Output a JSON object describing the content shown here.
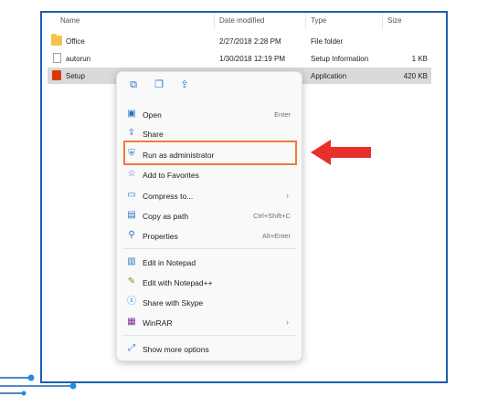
{
  "explorer": {
    "columns": {
      "name": "Name",
      "date": "Date modified",
      "type": "Type",
      "size": "Size"
    },
    "rows": [
      {
        "name": "Office",
        "date": "2/27/2018 2:28 PM",
        "type": "File folder",
        "size": "",
        "icon": "folder-icon"
      },
      {
        "name": "autorun",
        "date": "1/30/2018 12:19 PM",
        "type": "Setup Information",
        "size": "1 KB",
        "icon": "document-icon"
      },
      {
        "name": "Setup",
        "date": "",
        "type": "Application",
        "size": "420 KB",
        "icon": "office-app-icon"
      }
    ]
  },
  "context_menu": {
    "top_icons": [
      "copy-icon",
      "paste-icon",
      "share-icon"
    ],
    "items": [
      {
        "label": "Open",
        "shortcut": "Enter",
        "icon": "open-icon"
      },
      {
        "label": "Share",
        "shortcut": "",
        "icon": "share-icon"
      },
      {
        "label": "Run as administrator",
        "shortcut": "",
        "icon": "shield-icon"
      },
      {
        "label": "Add to Favorites",
        "shortcut": "",
        "icon": "star-icon"
      },
      {
        "label": "Compress to...",
        "shortcut": "",
        "icon": "zip-icon",
        "submenu": true
      },
      {
        "label": "Copy as path",
        "shortcut": "Ctrl+Shift+C",
        "icon": "path-icon"
      },
      {
        "label": "Properties",
        "shortcut": "Alt+Enter",
        "icon": "wrench-icon"
      },
      {
        "label": "Edit in Notepad",
        "shortcut": "",
        "icon": "notepad-icon"
      },
      {
        "label": "Edit with Notepad++",
        "shortcut": "",
        "icon": "notepadpp-icon"
      },
      {
        "label": "Share with Skype",
        "shortcut": "",
        "icon": "skype-icon"
      },
      {
        "label": "WinRAR",
        "shortcut": "",
        "icon": "winrar-icon",
        "submenu": true
      },
      {
        "label": "Show more options",
        "shortcut": "",
        "icon": "more-options-icon"
      }
    ]
  },
  "colors": {
    "frame": "#1d5fb0",
    "highlight": "#f07c3e",
    "arrow": "#e8302a",
    "accent": "#2b6fc7"
  }
}
